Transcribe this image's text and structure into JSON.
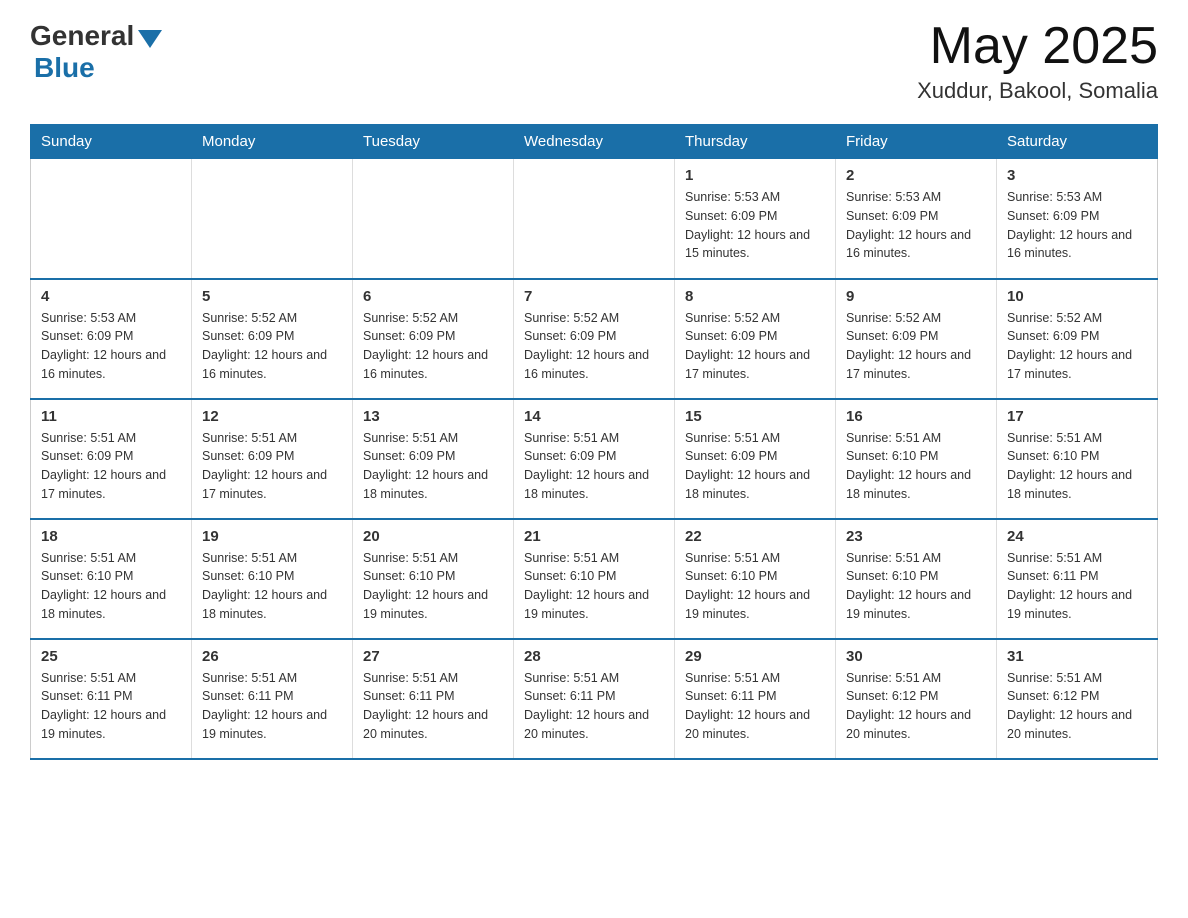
{
  "header": {
    "logo_general": "General",
    "logo_blue": "Blue",
    "month_year": "May 2025",
    "location": "Xuddur, Bakool, Somalia"
  },
  "weekdays": [
    "Sunday",
    "Monday",
    "Tuesday",
    "Wednesday",
    "Thursday",
    "Friday",
    "Saturday"
  ],
  "weeks": [
    [
      {
        "day": "",
        "sunrise": "",
        "sunset": "",
        "daylight": ""
      },
      {
        "day": "",
        "sunrise": "",
        "sunset": "",
        "daylight": ""
      },
      {
        "day": "",
        "sunrise": "",
        "sunset": "",
        "daylight": ""
      },
      {
        "day": "",
        "sunrise": "",
        "sunset": "",
        "daylight": ""
      },
      {
        "day": "1",
        "sunrise": "Sunrise: 5:53 AM",
        "sunset": "Sunset: 6:09 PM",
        "daylight": "Daylight: 12 hours and 15 minutes."
      },
      {
        "day": "2",
        "sunrise": "Sunrise: 5:53 AM",
        "sunset": "Sunset: 6:09 PM",
        "daylight": "Daylight: 12 hours and 16 minutes."
      },
      {
        "day": "3",
        "sunrise": "Sunrise: 5:53 AM",
        "sunset": "Sunset: 6:09 PM",
        "daylight": "Daylight: 12 hours and 16 minutes."
      }
    ],
    [
      {
        "day": "4",
        "sunrise": "Sunrise: 5:53 AM",
        "sunset": "Sunset: 6:09 PM",
        "daylight": "Daylight: 12 hours and 16 minutes."
      },
      {
        "day": "5",
        "sunrise": "Sunrise: 5:52 AM",
        "sunset": "Sunset: 6:09 PM",
        "daylight": "Daylight: 12 hours and 16 minutes."
      },
      {
        "day": "6",
        "sunrise": "Sunrise: 5:52 AM",
        "sunset": "Sunset: 6:09 PM",
        "daylight": "Daylight: 12 hours and 16 minutes."
      },
      {
        "day": "7",
        "sunrise": "Sunrise: 5:52 AM",
        "sunset": "Sunset: 6:09 PM",
        "daylight": "Daylight: 12 hours and 16 minutes."
      },
      {
        "day": "8",
        "sunrise": "Sunrise: 5:52 AM",
        "sunset": "Sunset: 6:09 PM",
        "daylight": "Daylight: 12 hours and 17 minutes."
      },
      {
        "day": "9",
        "sunrise": "Sunrise: 5:52 AM",
        "sunset": "Sunset: 6:09 PM",
        "daylight": "Daylight: 12 hours and 17 minutes."
      },
      {
        "day": "10",
        "sunrise": "Sunrise: 5:52 AM",
        "sunset": "Sunset: 6:09 PM",
        "daylight": "Daylight: 12 hours and 17 minutes."
      }
    ],
    [
      {
        "day": "11",
        "sunrise": "Sunrise: 5:51 AM",
        "sunset": "Sunset: 6:09 PM",
        "daylight": "Daylight: 12 hours and 17 minutes."
      },
      {
        "day": "12",
        "sunrise": "Sunrise: 5:51 AM",
        "sunset": "Sunset: 6:09 PM",
        "daylight": "Daylight: 12 hours and 17 minutes."
      },
      {
        "day": "13",
        "sunrise": "Sunrise: 5:51 AM",
        "sunset": "Sunset: 6:09 PM",
        "daylight": "Daylight: 12 hours and 18 minutes."
      },
      {
        "day": "14",
        "sunrise": "Sunrise: 5:51 AM",
        "sunset": "Sunset: 6:09 PM",
        "daylight": "Daylight: 12 hours and 18 minutes."
      },
      {
        "day": "15",
        "sunrise": "Sunrise: 5:51 AM",
        "sunset": "Sunset: 6:09 PM",
        "daylight": "Daylight: 12 hours and 18 minutes."
      },
      {
        "day": "16",
        "sunrise": "Sunrise: 5:51 AM",
        "sunset": "Sunset: 6:10 PM",
        "daylight": "Daylight: 12 hours and 18 minutes."
      },
      {
        "day": "17",
        "sunrise": "Sunrise: 5:51 AM",
        "sunset": "Sunset: 6:10 PM",
        "daylight": "Daylight: 12 hours and 18 minutes."
      }
    ],
    [
      {
        "day": "18",
        "sunrise": "Sunrise: 5:51 AM",
        "sunset": "Sunset: 6:10 PM",
        "daylight": "Daylight: 12 hours and 18 minutes."
      },
      {
        "day": "19",
        "sunrise": "Sunrise: 5:51 AM",
        "sunset": "Sunset: 6:10 PM",
        "daylight": "Daylight: 12 hours and 18 minutes."
      },
      {
        "day": "20",
        "sunrise": "Sunrise: 5:51 AM",
        "sunset": "Sunset: 6:10 PM",
        "daylight": "Daylight: 12 hours and 19 minutes."
      },
      {
        "day": "21",
        "sunrise": "Sunrise: 5:51 AM",
        "sunset": "Sunset: 6:10 PM",
        "daylight": "Daylight: 12 hours and 19 minutes."
      },
      {
        "day": "22",
        "sunrise": "Sunrise: 5:51 AM",
        "sunset": "Sunset: 6:10 PM",
        "daylight": "Daylight: 12 hours and 19 minutes."
      },
      {
        "day": "23",
        "sunrise": "Sunrise: 5:51 AM",
        "sunset": "Sunset: 6:10 PM",
        "daylight": "Daylight: 12 hours and 19 minutes."
      },
      {
        "day": "24",
        "sunrise": "Sunrise: 5:51 AM",
        "sunset": "Sunset: 6:11 PM",
        "daylight": "Daylight: 12 hours and 19 minutes."
      }
    ],
    [
      {
        "day": "25",
        "sunrise": "Sunrise: 5:51 AM",
        "sunset": "Sunset: 6:11 PM",
        "daylight": "Daylight: 12 hours and 19 minutes."
      },
      {
        "day": "26",
        "sunrise": "Sunrise: 5:51 AM",
        "sunset": "Sunset: 6:11 PM",
        "daylight": "Daylight: 12 hours and 19 minutes."
      },
      {
        "day": "27",
        "sunrise": "Sunrise: 5:51 AM",
        "sunset": "Sunset: 6:11 PM",
        "daylight": "Daylight: 12 hours and 20 minutes."
      },
      {
        "day": "28",
        "sunrise": "Sunrise: 5:51 AM",
        "sunset": "Sunset: 6:11 PM",
        "daylight": "Daylight: 12 hours and 20 minutes."
      },
      {
        "day": "29",
        "sunrise": "Sunrise: 5:51 AM",
        "sunset": "Sunset: 6:11 PM",
        "daylight": "Daylight: 12 hours and 20 minutes."
      },
      {
        "day": "30",
        "sunrise": "Sunrise: 5:51 AM",
        "sunset": "Sunset: 6:12 PM",
        "daylight": "Daylight: 12 hours and 20 minutes."
      },
      {
        "day": "31",
        "sunrise": "Sunrise: 5:51 AM",
        "sunset": "Sunset: 6:12 PM",
        "daylight": "Daylight: 12 hours and 20 minutes."
      }
    ]
  ]
}
